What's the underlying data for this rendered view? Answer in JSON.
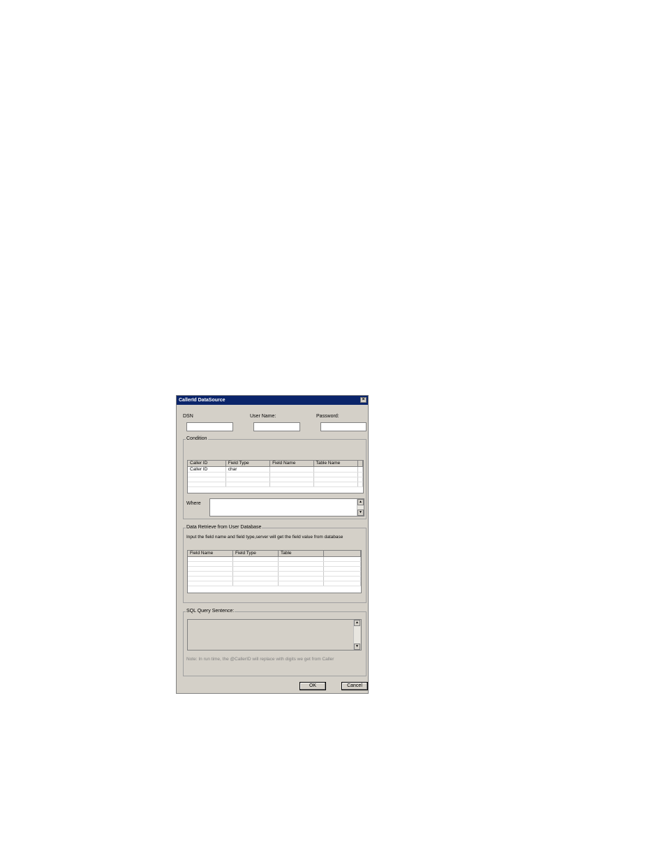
{
  "window": {
    "title": "CallerId DataSource",
    "close": "×"
  },
  "fields": {
    "dsn_label": "DSN",
    "user_label": "User Name:",
    "password_label": "Password:",
    "dsn_value": "",
    "user_value": "",
    "password_value": ""
  },
  "condition": {
    "group_title": "Condition",
    "columns": [
      "Caller ID",
      "Field Type",
      "Field Name",
      "Table Name"
    ],
    "rows": [
      [
        "Caller ID",
        "char",
        "",
        ""
      ],
      [
        "",
        "",
        "",
        ""
      ],
      [
        "",
        "",
        "",
        ""
      ],
      [
        "",
        "",
        "",
        ""
      ]
    ],
    "where_label": "Where",
    "where_value": ""
  },
  "retrieve": {
    "group_title": "Data Retrieve from User Database",
    "description": "Input the field name and field type,server will get the field value from database",
    "columns": [
      "Field Name",
      "Field Type",
      "Table",
      ""
    ],
    "rows": [
      [
        "",
        "",
        "",
        ""
      ],
      [
        "",
        "",
        "",
        ""
      ],
      [
        "",
        "",
        "",
        ""
      ],
      [
        "",
        "",
        "",
        ""
      ],
      [
        "",
        "",
        "",
        ""
      ],
      [
        "",
        "",
        "",
        ""
      ]
    ]
  },
  "sql": {
    "group_title": "SQL Query Sentence:",
    "value": "",
    "note": "Note: In run time, the @CallerID will replace with digits we get from Caller"
  },
  "buttons": {
    "ok": "OK",
    "cancel": "Cancel"
  },
  "icons": {
    "scroll_up": "▲",
    "scroll_down": "▼"
  }
}
